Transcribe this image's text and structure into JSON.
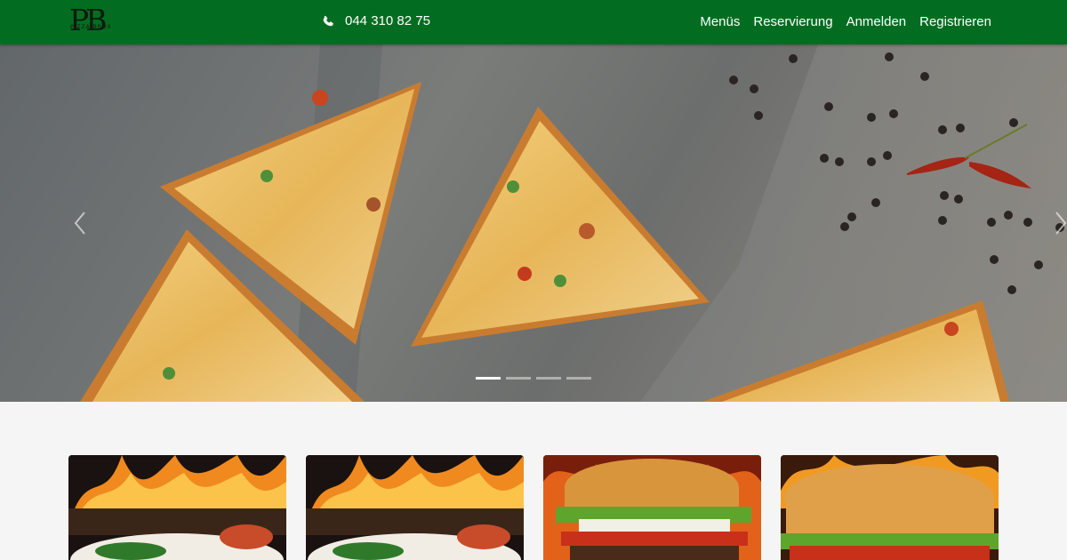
{
  "header": {
    "logo_initials": "PB",
    "logo_text": "PIZZA BROS",
    "phone": "044 310 82 75",
    "nav": [
      "Menüs",
      "Reservierung",
      "Anmelden",
      "Registrieren"
    ]
  },
  "hero": {
    "slide_count": 4,
    "active_slide": 1
  },
  "colors": {
    "header_bg": "#026d20",
    "page_bg": "#f5f5f5"
  },
  "cards": [
    {
      "image": "pasta-fire-image"
    },
    {
      "image": "pasta-fire-image"
    },
    {
      "image": "burger-fire-image"
    },
    {
      "image": "burger-image"
    }
  ]
}
